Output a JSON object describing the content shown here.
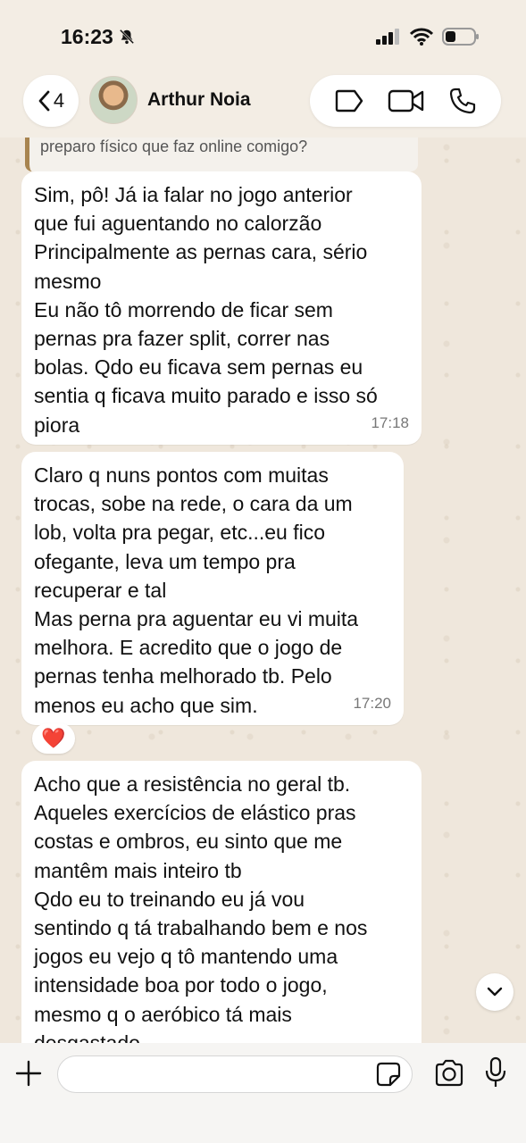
{
  "status_bar": {
    "time": "16:23"
  },
  "header": {
    "back_count": "4",
    "contact_name": "Arthur Noia"
  },
  "messages": [
    {
      "quote": "preparo físico que faz online comigo?",
      "lines": [
        "Sim, pô! Já ia falar no jogo anterior",
        "que fui aguentando no calorzão",
        "Principalmente as pernas cara, sério",
        "mesmo",
        "Eu não tô morrendo de ficar sem",
        "pernas pra fazer split, correr nas",
        "bolas. Qdo eu ficava sem pernas eu",
        "sentia q ficava muito parado e isso só",
        "piora"
      ],
      "time": "17:18"
    },
    {
      "lines": [
        "Claro q nuns pontos com muitas",
        "trocas, sobe na rede, o cara da um",
        "lob, volta pra pegar, etc...eu fico",
        "ofegante, leva um tempo pra",
        "recuperar e tal",
        "Mas perna pra aguentar eu vi muita",
        "melhora. E acredito que o jogo de",
        "pernas tenha melhorado tb. Pelo",
        "menos eu acho que sim."
      ],
      "time": "17:20",
      "reaction": "❤️"
    },
    {
      "lines": [
        "Acho que a resistência no geral tb.",
        "Aqueles exercícios de elástico pras",
        "costas e ombros, eu sinto que me",
        "mantêm mais inteiro tb",
        "Qdo eu to treinando eu já vou",
        "sentindo q tá trabalhando bem e nos",
        "jogos eu vejo q tô mantendo uma",
        "intensidade boa por todo o jogo,",
        "mesmo q o aeróbico tá mais",
        "desgastado"
      ]
    }
  ],
  "composer": {
    "value": ""
  },
  "icons": {
    "back": "chevron-left-icon",
    "label": "label-tag-icon",
    "video": "video-camera-icon",
    "phone": "phone-icon",
    "plus": "plus-icon",
    "sticker": "sticker-icon",
    "camera": "camera-icon",
    "mic": "microphone-icon",
    "scroll": "chevron-down-icon"
  },
  "colors": {
    "chat_background": "#efe7dc",
    "quote_bar": "#a8844f",
    "heart": "#e0102a"
  }
}
